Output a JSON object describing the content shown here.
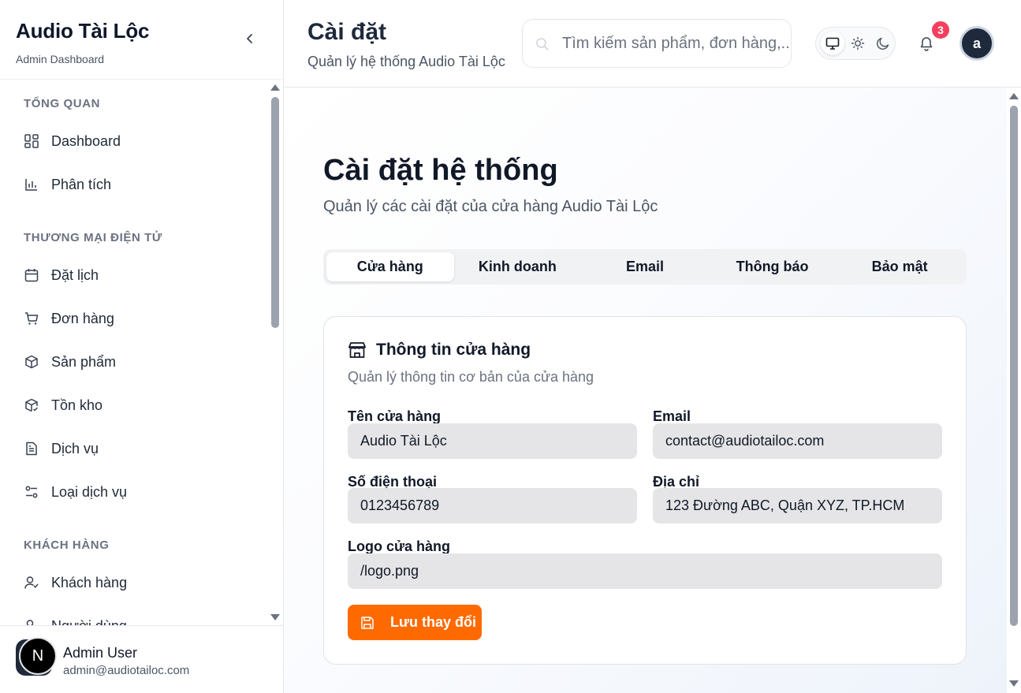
{
  "sidebar": {
    "brand": "Audio Tài Lộc",
    "subtitle": "Admin Dashboard",
    "sections": [
      {
        "title": "TỔNG QUAN",
        "items": [
          {
            "label": "Dashboard",
            "icon": "dashboard-icon"
          },
          {
            "label": "Phân tích",
            "icon": "chart-icon"
          }
        ]
      },
      {
        "title": "THƯƠNG MẠI ĐIỆN TỬ",
        "items": [
          {
            "label": "Đặt lịch",
            "icon": "calendar-icon"
          },
          {
            "label": "Đơn hàng",
            "icon": "cart-icon"
          },
          {
            "label": "Sản phẩm",
            "icon": "package-icon"
          },
          {
            "label": "Tồn kho",
            "icon": "package-check-icon"
          },
          {
            "label": "Dịch vụ",
            "icon": "file-icon"
          },
          {
            "label": "Loại dịch vụ",
            "icon": "settings-sliders-icon"
          }
        ]
      },
      {
        "title": "KHÁCH HÀNG",
        "items": [
          {
            "label": "Khách hàng",
            "icon": "user-check-icon"
          },
          {
            "label": "Người dùng",
            "icon": "users-icon"
          }
        ]
      }
    ],
    "user": {
      "avatar_letter": "N",
      "name": "Admin User",
      "email": "admin@audiotailoc.com"
    }
  },
  "header": {
    "title": "Cài đặt",
    "subtitle": "Quản lý hệ thống Audio Tài Lộc",
    "search_placeholder": "Tìm kiếm sản phẩm, đơn hàng,...",
    "theme_options": [
      "monitor-icon",
      "sun-icon",
      "moon-icon"
    ],
    "notification_count": "3",
    "avatar_letter": "a"
  },
  "main": {
    "title": "Cài đặt hệ thống",
    "subtitle": "Quản lý các cài đặt của cửa hàng Audio Tài Lộc",
    "tabs": [
      "Cửa hàng",
      "Kinh doanh",
      "Email",
      "Thông báo",
      "Bảo mật"
    ],
    "active_tab": "Cửa hàng",
    "card": {
      "title": "Thông tin cửa hàng",
      "subtitle": "Quản lý thông tin cơ bản của cửa hàng",
      "fields": {
        "store_name": {
          "label": "Tên cửa hàng",
          "value": "Audio Tài Lộc"
        },
        "email": {
          "label": "Email",
          "value": "contact@audiotailoc.com"
        },
        "phone": {
          "label": "Số điện thoại",
          "value": "0123456789"
        },
        "address": {
          "label": "Địa chỉ",
          "value": "123 Đường ABC, Quận XYZ, TP.HCM"
        },
        "logo": {
          "label": "Logo cửa hàng",
          "value": "/logo.png"
        }
      },
      "save_label": "Lưu thay đổi"
    }
  },
  "colors": {
    "accent": "#ff6a00",
    "badge": "#f43f5e",
    "input_bg": "#e5e5e7"
  }
}
